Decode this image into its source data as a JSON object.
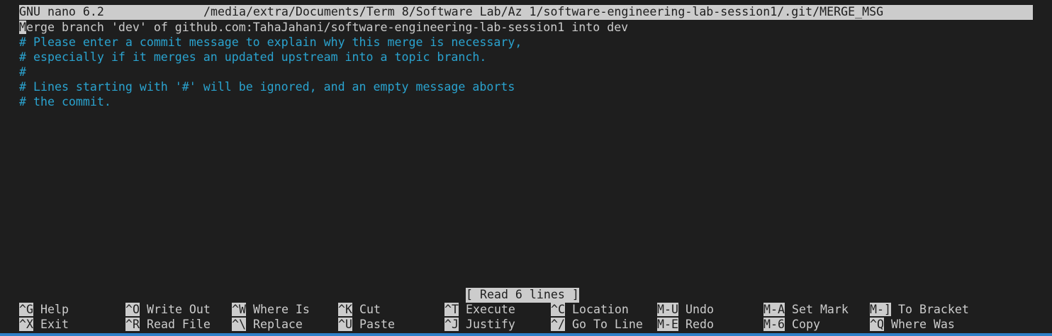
{
  "titlebar": {
    "program": "GNU nano 6.2",
    "filepath": "/media/extra/Documents/Term 8/Software Lab/Az 1/software-engineering-lab-session1/.git/MERGE_MSG"
  },
  "editor": {
    "first_line_cursor_char": "M",
    "first_line_rest": "erge branch 'dev' of github.com:TahaJahani/software-engineering-lab-session1 into dev",
    "comment_lines": [
      "# Please enter a commit message to explain why this merge is necessary,",
      "# especially if it merges an updated upstream into a topic branch.",
      "#",
      "# Lines starting with '#' will be ignored, and an empty message aborts",
      "# the commit."
    ]
  },
  "status": "[ Read 6 lines ]",
  "shortcuts_row1": [
    {
      "key": "^G",
      "label": "Help"
    },
    {
      "key": "^O",
      "label": "Write Out"
    },
    {
      "key": "^W",
      "label": "Where Is"
    },
    {
      "key": "^K",
      "label": "Cut"
    },
    {
      "key": "^T",
      "label": "Execute"
    },
    {
      "key": "^C",
      "label": "Location"
    },
    {
      "key": "M-U",
      "label": "Undo"
    },
    {
      "key": "M-A",
      "label": "Set Mark"
    },
    {
      "key": "M-]",
      "label": "To Bracket"
    }
  ],
  "shortcuts_row2": [
    {
      "key": "^X",
      "label": "Exit"
    },
    {
      "key": "^R",
      "label": "Read File"
    },
    {
      "key": "^\\",
      "label": "Replace"
    },
    {
      "key": "^U",
      "label": "Paste"
    },
    {
      "key": "^J",
      "label": "Justify"
    },
    {
      "key": "^/",
      "label": "Go To Line"
    },
    {
      "key": "M-E",
      "label": "Redo"
    },
    {
      "key": "M-6",
      "label": "Copy"
    },
    {
      "key": "^Q",
      "label": "Where Was"
    }
  ],
  "colors": {
    "background": "#1e1e1e",
    "foreground": "#cccccc",
    "comment": "#2aa3cf",
    "inverse_bg": "#cccccc"
  }
}
